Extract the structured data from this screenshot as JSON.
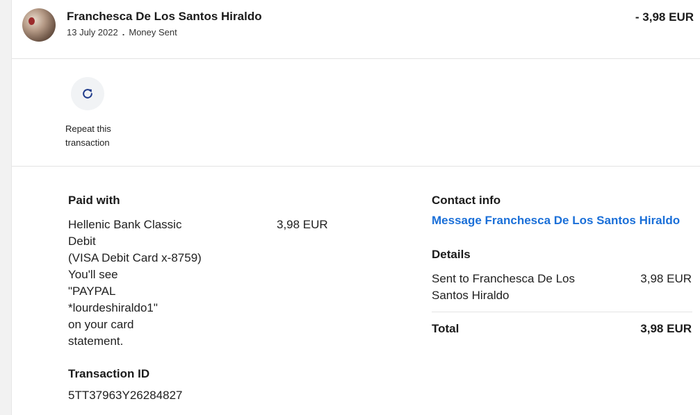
{
  "header": {
    "name": "Franchesca De Los Santos Hiraldo",
    "date": "13 July 2022",
    "separator": ".",
    "type": "Money Sent",
    "amount": "- 3,98 EUR"
  },
  "repeat": {
    "icon": "refresh-icon",
    "label": "Repeat this transaction"
  },
  "paid_with": {
    "heading": "Paid with",
    "lines": [
      "Hellenic Bank Classic",
      "Debit",
      "(VISA Debit Card x-8759)",
      "You'll see",
      "\"PAYPAL",
      "*lourdeshiraldo1\"",
      "on your card",
      "statement."
    ],
    "amount": "3,98 EUR"
  },
  "transaction": {
    "heading": "Transaction ID",
    "id": "5TT37963Y26284827"
  },
  "contact": {
    "heading": "Contact info",
    "link": "Message Franchesca De Los Santos Hiraldo"
  },
  "details": {
    "heading": "Details",
    "sent_to_lines": [
      "Sent to Franchesca De Los",
      "Santos Hiraldo"
    ],
    "sent_amount": "3,98 EUR",
    "total_label": "Total",
    "total_amount": "3,98 EUR"
  },
  "colors": {
    "link": "#1a6fd8",
    "divider": "#e3e3e3"
  }
}
